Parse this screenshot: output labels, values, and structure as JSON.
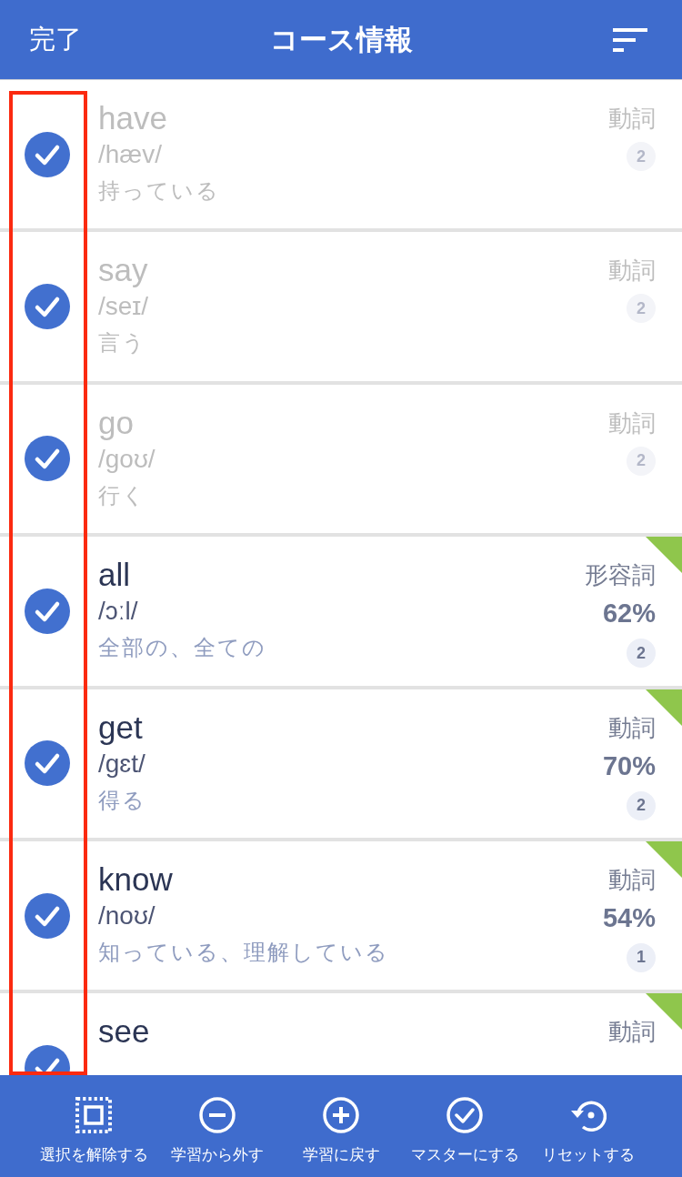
{
  "header": {
    "done_label": "完了",
    "title": "コース情報"
  },
  "words": [
    {
      "word": "have",
      "phonetic": "/hæv/",
      "meaning": "持っている",
      "part_of_speech": "動詞",
      "count": "2",
      "checked": true,
      "dimmed": true,
      "flagged": false
    },
    {
      "word": "say",
      "phonetic": "/seɪ/",
      "meaning": "言う",
      "part_of_speech": "動詞",
      "count": "2",
      "checked": true,
      "dimmed": true,
      "flagged": false
    },
    {
      "word": "go",
      "phonetic": "/goʊ/",
      "meaning": "行く",
      "part_of_speech": "動詞",
      "count": "2",
      "checked": true,
      "dimmed": true,
      "flagged": false
    },
    {
      "word": "all",
      "phonetic": "/ɔːl/",
      "meaning": "全部の、全ての",
      "part_of_speech": "形容詞",
      "percent": "62%",
      "count": "2",
      "checked": true,
      "dimmed": false,
      "flagged": true
    },
    {
      "word": "get",
      "phonetic": "/gɛt/",
      "meaning": "得る",
      "part_of_speech": "動詞",
      "percent": "70%",
      "count": "2",
      "checked": true,
      "dimmed": false,
      "flagged": true
    },
    {
      "word": "know",
      "phonetic": "/noʊ/",
      "meaning": "知っている、理解している",
      "part_of_speech": "動詞",
      "percent": "54%",
      "count": "1",
      "checked": true,
      "dimmed": false,
      "flagged": true
    },
    {
      "word": "see",
      "part_of_speech": "動詞",
      "checked": true,
      "dimmed": false,
      "flagged": true
    }
  ],
  "toolbar": [
    {
      "kind": "deselect",
      "label": "選択を解除する"
    },
    {
      "kind": "remove",
      "label": "学習から外す"
    },
    {
      "kind": "restore",
      "label": "学習に戻す"
    },
    {
      "kind": "master",
      "label": "マスターにする"
    },
    {
      "kind": "reset",
      "label": "リセットする"
    }
  ]
}
